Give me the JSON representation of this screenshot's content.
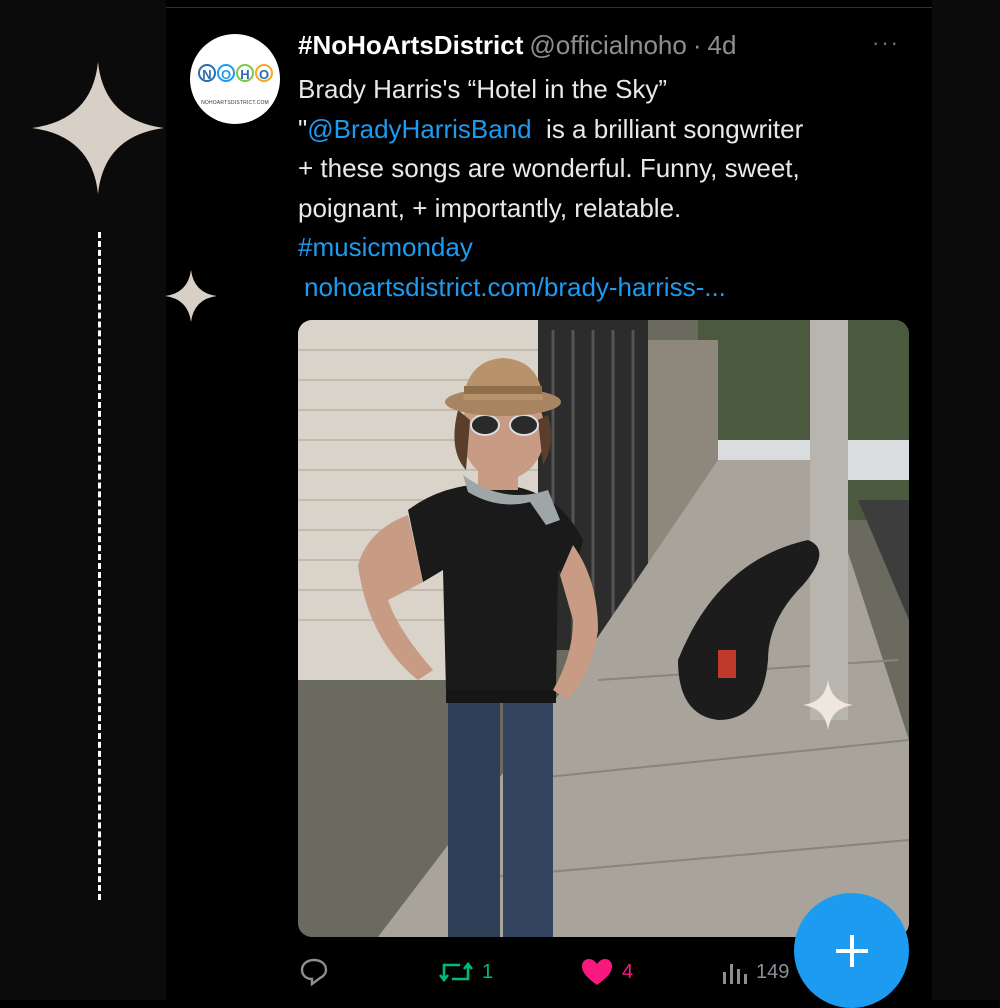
{
  "tweet": {
    "display_name": "#NoHoArtsDistrict",
    "handle": "@officialnoho",
    "separator": "·",
    "time": "4d",
    "more_label": "···",
    "text_lines": [
      "Brady Harris's  “Hotel in the Sky”",
      "\"",
      "@BradyHarrisBand",
      "  is a brilliant songwriter",
      "+ these songs are wonderful. Funny, sweet,",
      "poignant, + importantly, relatable.",
      "#musicmonday",
      "nohoartsdistrict.com/brady-harriss-..."
    ],
    "avatar": {
      "logo_letters": [
        "N",
        "O",
        "H",
        "O"
      ],
      "logo_colors": [
        "#2b6cb0",
        "#1d9bf0",
        "#7ac943",
        "#f5a623"
      ],
      "logo_sub": "NOHOARTSDISTRICT.COM"
    },
    "media": {
      "icon": "photo-image",
      "description_colors": {
        "wall": "#d9d3c9",
        "sidewalk": "#a9a49b",
        "shirt": "#1a1a1a",
        "jeans": "#2e3f57",
        "hat": "#b7926b"
      }
    }
  },
  "actions": {
    "reply": {
      "icon": "reply-icon",
      "count": ""
    },
    "retweet": {
      "icon": "retweet-icon",
      "count": "1"
    },
    "like": {
      "icon": "heart-icon",
      "count": "4"
    },
    "views": {
      "icon": "views-icon",
      "count": "149"
    }
  },
  "fab": {
    "icon": "plus-icon",
    "color": "#1d9bf0"
  },
  "theme": {
    "accent": "#1d9bf0",
    "retweet": "#00ba7c",
    "like": "#f91880",
    "muted": "#8b9095",
    "star": "#d8cfc6"
  }
}
